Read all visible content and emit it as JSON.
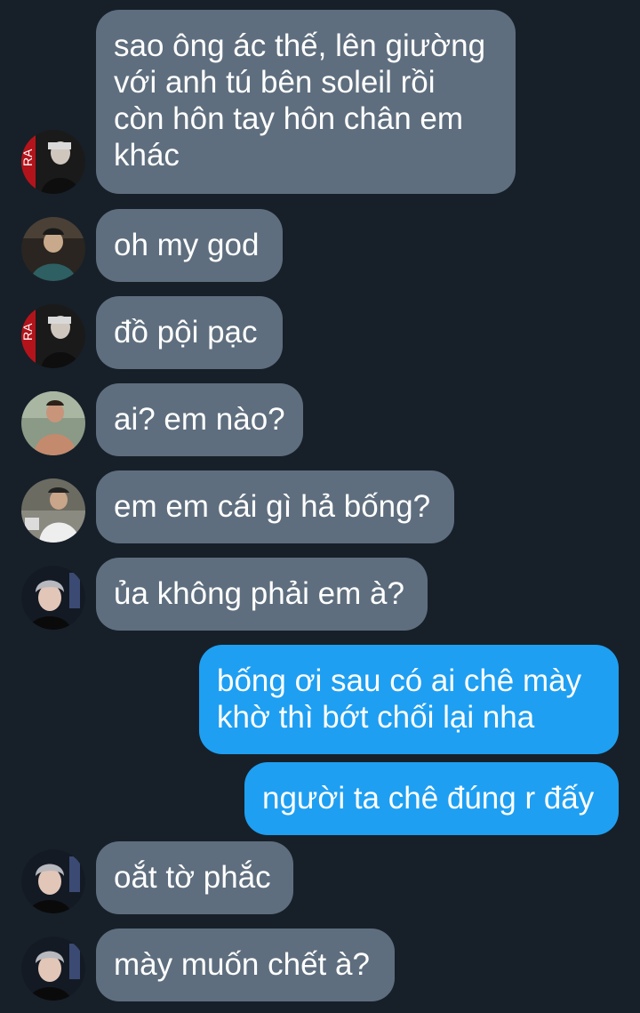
{
  "colors": {
    "background": "#172029",
    "incoming_bubble": "#5e6e7e",
    "outgoing_bubble": "#1e9ff2",
    "text": "#ffffff"
  },
  "messages": [
    {
      "direction": "incoming",
      "avatar": "avatar-red-background-person-icon",
      "text": "sao ông ác thế, lên giường\nvới anh tú bên soleil rồi\ncòn hôn tay hôn chân em\nkhác"
    },
    {
      "direction": "incoming",
      "avatar": "avatar-teal-jacket-person-icon",
      "text": "oh my god"
    },
    {
      "direction": "incoming",
      "avatar": "avatar-red-background-person-icon",
      "text": "đồ pội pạc"
    },
    {
      "direction": "incoming",
      "avatar": "avatar-shirtless-person-icon",
      "text": "ai? em nào?"
    },
    {
      "direction": "incoming",
      "avatar": "avatar-white-shirt-person-icon",
      "text": "em em cái gì hả bống?"
    },
    {
      "direction": "incoming",
      "avatar": "avatar-silver-hair-person-icon",
      "text": "ủa không phải em à?"
    },
    {
      "direction": "outgoing",
      "text": "bống ơi sau có ai chê mày\nkhờ thì bớt chối lại nha"
    },
    {
      "direction": "outgoing",
      "text": "người ta chê đúng r đấy"
    },
    {
      "direction": "incoming",
      "avatar": "avatar-silver-hair-person-icon",
      "text": "oắt tờ phắc"
    },
    {
      "direction": "incoming",
      "avatar": "avatar-silver-hair-person-icon",
      "text": "mày muốn chết à?"
    }
  ]
}
